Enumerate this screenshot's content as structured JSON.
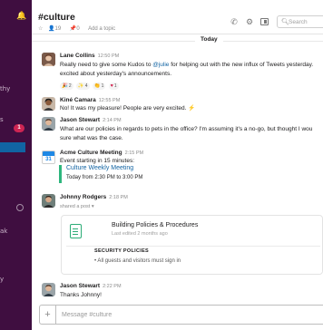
{
  "sidebar": {
    "frag_1": "thy",
    "frag_2": "s",
    "badge": "1",
    "frag_3": "ak",
    "frag_4": "y"
  },
  "header": {
    "channel": "#culture",
    "members": "19",
    "pins": "0",
    "add_topic": "Add a topic",
    "search_placeholder": "Search"
  },
  "day_label": "Today",
  "messages": {
    "m1": {
      "name": "Lane Collins",
      "time": "12:50 PM",
      "line1_before": "Really need to give some Kudos to ",
      "mention": "@julie",
      "line1_after": " for helping out with the new influx of Tweets yesterday.",
      "line2": "excited about yesterday's announcements."
    },
    "reactions": [
      {
        "icon": "party-popper",
        "glyph": "🎉",
        "count": "2"
      },
      {
        "icon": "sparkles",
        "glyph": "✨",
        "count": "4"
      },
      {
        "icon": "clapping-hands",
        "glyph": "👏",
        "count": "1"
      },
      {
        "icon": "heart",
        "glyph": "♥",
        "count": "1"
      }
    ],
    "m2": {
      "name": "Kiné Camara",
      "time": "12:55 PM",
      "text": "No! It was my pleasure! People are very excited. ⚡"
    },
    "m3": {
      "name": "Jason Stewart",
      "time": "2:14 PM",
      "line1": "What are our policies in regards to pets in the office? I'm assuming it's a no-go, but thought I wou",
      "line2": "sure what was the case."
    },
    "m4": {
      "name": "Acme Culture Meeting",
      "time": "2:15 PM",
      "text": "Event starting in 15 minutes:",
      "calendar_day": "31",
      "event_title": "Culture Weekly Meeting",
      "event_time": "Today from 2:30 PM to 3:00 PM"
    },
    "m5": {
      "name": "Johnny Rodgers",
      "time": "2:18 PM",
      "shared": "shared a post",
      "post_title": "Building Policies & Procedures",
      "post_sub": "Last edited 2 months ago",
      "post_section": "SECURITY POLICIES",
      "post_bullet": "• All guests and visitors must sign in"
    },
    "m6": {
      "name": "Jason Stewart",
      "time": "2:22 PM",
      "text": "Thanks Johnny!"
    }
  },
  "composer": {
    "placeholder": "Message #culture"
  },
  "colors": {
    "sidebar_bg": "#3f0e40",
    "active_item": "#1164a3",
    "badge": "#cd2553",
    "link": "#1264a3",
    "event_bar": "#2eb67d"
  }
}
